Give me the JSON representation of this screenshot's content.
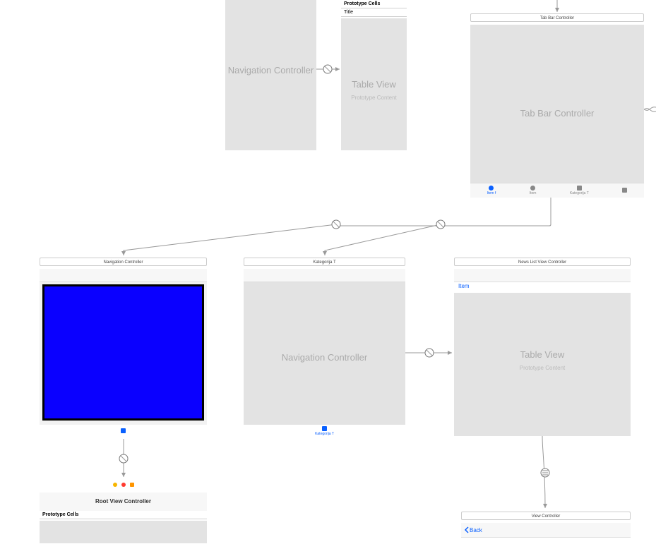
{
  "scenes": {
    "navTop": {
      "title": "Navigation Controller",
      "placeholder": "Navigation Controller"
    },
    "tableTop": {
      "prototypeHeader": "Prototype Cells",
      "cellTitle": "Title",
      "placeholder": "Table View",
      "sub": "Prototype Content"
    },
    "tabBar": {
      "title": "Tab Bar Controller",
      "placeholder": "Tab Bar Controller",
      "items": [
        {
          "label": "Item f",
          "active": true,
          "shape": "circ"
        },
        {
          "label": "Item",
          "active": false,
          "shape": "circ"
        },
        {
          "label": "Kategorija T",
          "active": false,
          "shape": "sq"
        },
        {
          "label": "",
          "active": false,
          "shape": "sq"
        }
      ]
    },
    "navBlue": {
      "title": "Navigation Controller",
      "tabLabel": ""
    },
    "root": {
      "title": "Root View Controller",
      "prototypeHeader": "Prototype Cells"
    },
    "navKat": {
      "title": "Kategorija T",
      "placeholder": "Navigation Controller",
      "tabLabel": "Kategorija T"
    },
    "newsList": {
      "title": "News List View Controller",
      "itemLabel": "Item",
      "placeholder": "Table View",
      "sub": "Prototype Content"
    },
    "viewCtrl": {
      "title": "View Controller",
      "back": "Back"
    }
  }
}
